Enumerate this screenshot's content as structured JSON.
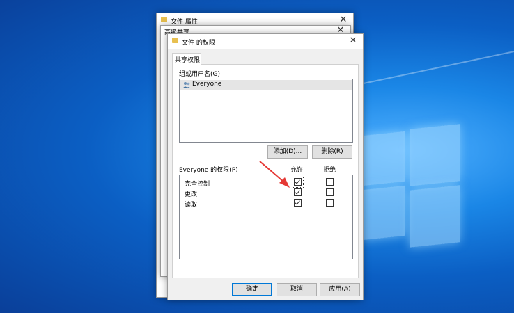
{
  "back_window_1": {
    "title": "文件 属性"
  },
  "back_window_2": {
    "title": "高级共享"
  },
  "dialog": {
    "title": "文件 的权限",
    "tab_label": "共享权限",
    "group_label": "组或用户名(G):",
    "users": [
      {
        "name": "Everyone",
        "icon": "users-group-icon"
      }
    ],
    "add_button": "添加(D)...",
    "remove_button": "删除(R)",
    "permissions_label": "Everyone 的权限(P)",
    "allow_header": "允许",
    "deny_header": "拒绝",
    "permissions": [
      {
        "name": "完全控制",
        "allow": true,
        "deny": false
      },
      {
        "name": "更改",
        "allow": true,
        "deny": false
      },
      {
        "name": "读取",
        "allow": true,
        "deny": false
      }
    ],
    "ok_button": "确定",
    "cancel_button": "取消",
    "apply_button": "应用(A)"
  },
  "colors": {
    "accent": "#0078d7",
    "annotation_arrow": "#e53935"
  }
}
